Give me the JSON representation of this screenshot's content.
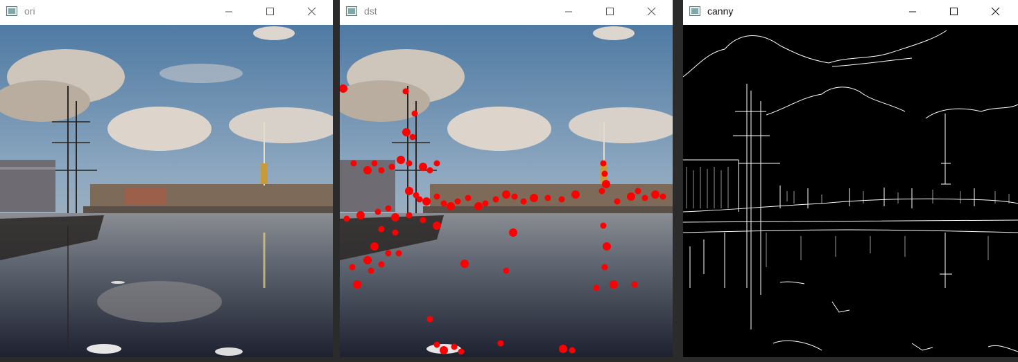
{
  "windows": [
    {
      "title": "ori",
      "active": false,
      "kind": "photo"
    },
    {
      "title": "dst",
      "active": false,
      "kind": "photo-corners"
    },
    {
      "title": "canny",
      "active": true,
      "kind": "edges"
    }
  ],
  "controls": {
    "minimize": "minimize-icon",
    "maximize": "maximize-icon",
    "close": "close-icon"
  },
  "colors": {
    "sky_top": "#5b86ad",
    "sky_horizon": "#c8c5c0",
    "cloud": "#d9d3cc",
    "water_top": "#7c7f86",
    "water_bottom": "#1f2230",
    "shore": "#6d5a4a",
    "corner_marker": "#ff0000",
    "edge_background": "#000000",
    "edge_line": "#ffffff",
    "desktop": "#2b2b2b"
  }
}
